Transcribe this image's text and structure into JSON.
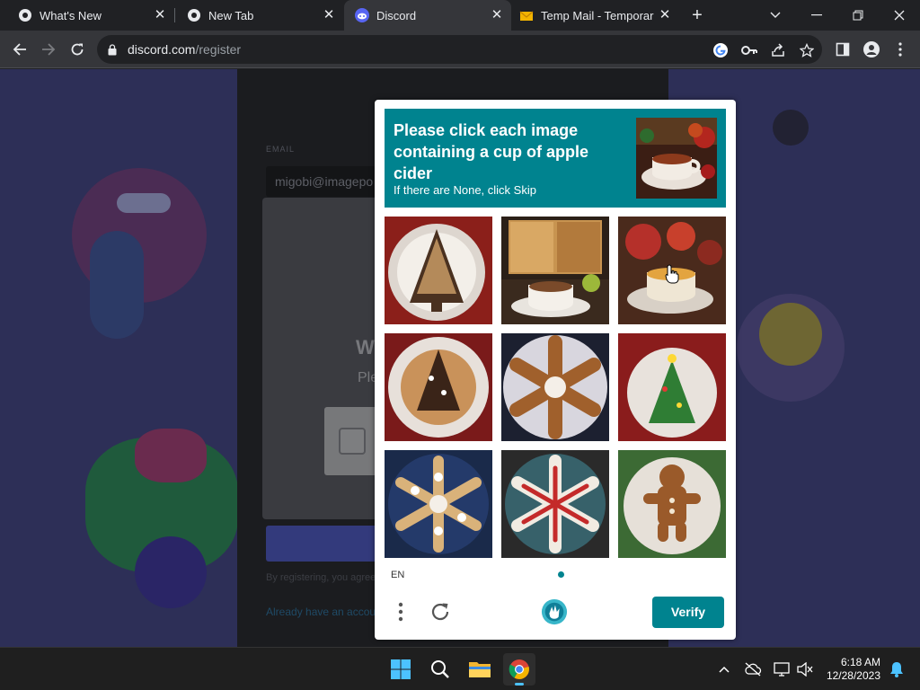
{
  "browser": {
    "tabs": [
      {
        "title": "What's New",
        "icon": "chrome-icon",
        "active": false
      },
      {
        "title": "New Tab",
        "icon": "chrome-icon",
        "active": false
      },
      {
        "title": "Discord",
        "icon": "discord-icon",
        "active": true
      },
      {
        "title": "Temp Mail - Temporar",
        "icon": "envelope-icon",
        "active": false
      }
    ],
    "url_host": "discord.com",
    "url_path": "/register"
  },
  "discord": {
    "email_label": "EMAIL",
    "email_value": "migobi@imagepo",
    "modal_heading": "W",
    "modal_sub": "Ple",
    "small_text": "By registering, you agree",
    "link_text": "Already have an account?"
  },
  "captcha": {
    "prompt": "Please click each image containing a cup of apple cider",
    "hint": "If there are None, click Skip",
    "sample_image": "cup-of-apple-cider-image",
    "tiles": [
      "gingerbread-tree-cookie-image",
      "cup-of-apple-cider-by-window-image",
      "apple-cider-with-apples-image",
      "christmas-tree-cookie-image",
      "snowflake-cookie-image",
      "green-christmas-tree-cookie-image",
      "blue-snowflake-cookie-image",
      "red-snowflake-cookie-image",
      "gingerbread-man-cookie-image"
    ],
    "language": "EN",
    "verify_label": "Verify",
    "accent": "#00838f"
  },
  "taskbar": {
    "time": "6:18 AM",
    "date": "12/28/2023"
  }
}
